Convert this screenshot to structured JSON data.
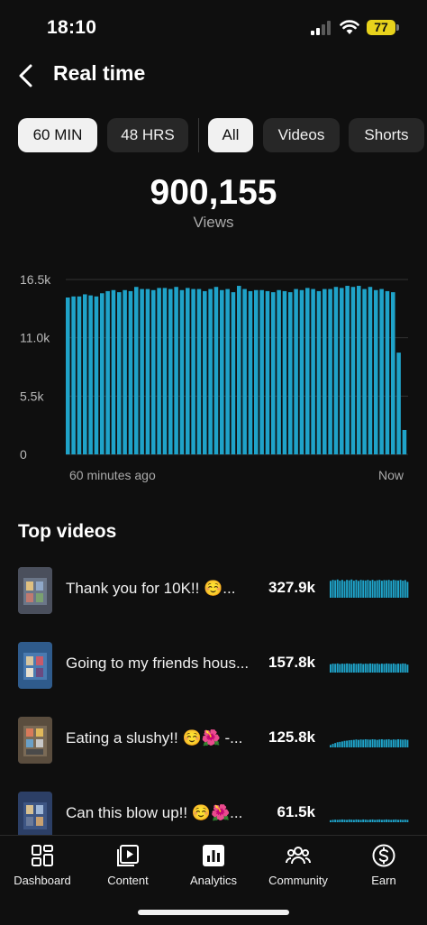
{
  "status_bar": {
    "time": "18:10",
    "battery": "77"
  },
  "header": {
    "title": "Real time"
  },
  "filters": {
    "time_range": [
      {
        "label": "60 MIN",
        "active": true
      },
      {
        "label": "48 HRS",
        "active": false
      }
    ],
    "content_type": [
      {
        "label": "All",
        "active": true
      },
      {
        "label": "Videos",
        "active": false
      },
      {
        "label": "Shorts",
        "active": false
      }
    ]
  },
  "summary": {
    "total_views": "900,155",
    "views_label": "Views"
  },
  "chart_data": {
    "type": "bar",
    "y_ticks": [
      "16.5k",
      "11.0k",
      "5.5k",
      "0"
    ],
    "x_labels": [
      "60 minutes ago",
      "Now"
    ],
    "ylim": [
      0,
      16500
    ],
    "grid": true,
    "color": "#1fa3c9",
    "values": [
      14800,
      14900,
      14900,
      15100,
      15000,
      14900,
      15200,
      15400,
      15500,
      15300,
      15500,
      15400,
      15800,
      15600,
      15600,
      15500,
      15700,
      15700,
      15600,
      15800,
      15500,
      15700,
      15600,
      15600,
      15400,
      15600,
      15800,
      15500,
      15600,
      15300,
      15900,
      15600,
      15400,
      15500,
      15500,
      15400,
      15300,
      15500,
      15400,
      15300,
      15600,
      15500,
      15700,
      15600,
      15400,
      15600,
      15600,
      15800,
      15700,
      15900,
      15800,
      15900,
      15600,
      15800,
      15500,
      15600,
      15400,
      15300,
      9600,
      2300
    ]
  },
  "top_videos": {
    "title": "Top videos",
    "items": [
      {
        "title": "Thank you for 10K!! ☺️...",
        "views": "327.9k",
        "spark": [
          0.85,
          0.9,
          0.88,
          0.92,
          0.86,
          0.9,
          0.84,
          0.9,
          0.88,
          0.92,
          0.86,
          0.9,
          0.85,
          0.9,
          0.88,
          0.87,
          0.9,
          0.86,
          0.9,
          0.85,
          0.88,
          0.9,
          0.86,
          0.89,
          0.88,
          0.9,
          0.86,
          0.9,
          0.88,
          0.87,
          0.9,
          0.86,
          0.89,
          0.8
        ],
        "thumb_color": "#4a4f5c"
      },
      {
        "title": "Going to my friends hous...",
        "views": "157.8k",
        "spark": [
          0.42,
          0.45,
          0.44,
          0.46,
          0.43,
          0.45,
          0.44,
          0.46,
          0.45,
          0.43,
          0.46,
          0.44,
          0.45,
          0.46,
          0.43,
          0.45,
          0.44,
          0.46,
          0.45,
          0.44,
          0.46,
          0.43,
          0.45,
          0.44,
          0.46,
          0.45,
          0.44,
          0.46,
          0.43,
          0.45,
          0.44,
          0.46,
          0.45,
          0.4
        ],
        "thumb_color": "#2f5b8c"
      },
      {
        "title": "Eating a slushy!! ☺️🌺 -...",
        "views": "125.8k",
        "spark": [
          0.12,
          0.18,
          0.22,
          0.26,
          0.28,
          0.3,
          0.33,
          0.34,
          0.36,
          0.37,
          0.38,
          0.4,
          0.38,
          0.4,
          0.39,
          0.41,
          0.4,
          0.39,
          0.41,
          0.4,
          0.38,
          0.4,
          0.41,
          0.39,
          0.4,
          0.41,
          0.38,
          0.4,
          0.39,
          0.41,
          0.4,
          0.39,
          0.4,
          0.38
        ],
        "thumb_color": "#5a4d3e"
      },
      {
        "title": "Can this blow up!! ☺️🌺...",
        "views": "61.5k",
        "spark": [
          0.1,
          0.12,
          0.13,
          0.12,
          0.13,
          0.14,
          0.13,
          0.12,
          0.14,
          0.13,
          0.12,
          0.14,
          0.13,
          0.12,
          0.14,
          0.13,
          0.12,
          0.13,
          0.14,
          0.12,
          0.13,
          0.14,
          0.12,
          0.13,
          0.14,
          0.13,
          0.12,
          0.13,
          0.14,
          0.12,
          0.13,
          0.12,
          0.13,
          0.12
        ],
        "thumb_color": "#2c3f66"
      }
    ]
  },
  "bottom_nav": [
    {
      "label": "Dashboard",
      "icon": "dashboard-icon"
    },
    {
      "label": "Content",
      "icon": "content-icon"
    },
    {
      "label": "Analytics",
      "icon": "analytics-icon",
      "active": true
    },
    {
      "label": "Community",
      "icon": "community-icon"
    },
    {
      "label": "Earn",
      "icon": "earn-icon"
    }
  ]
}
